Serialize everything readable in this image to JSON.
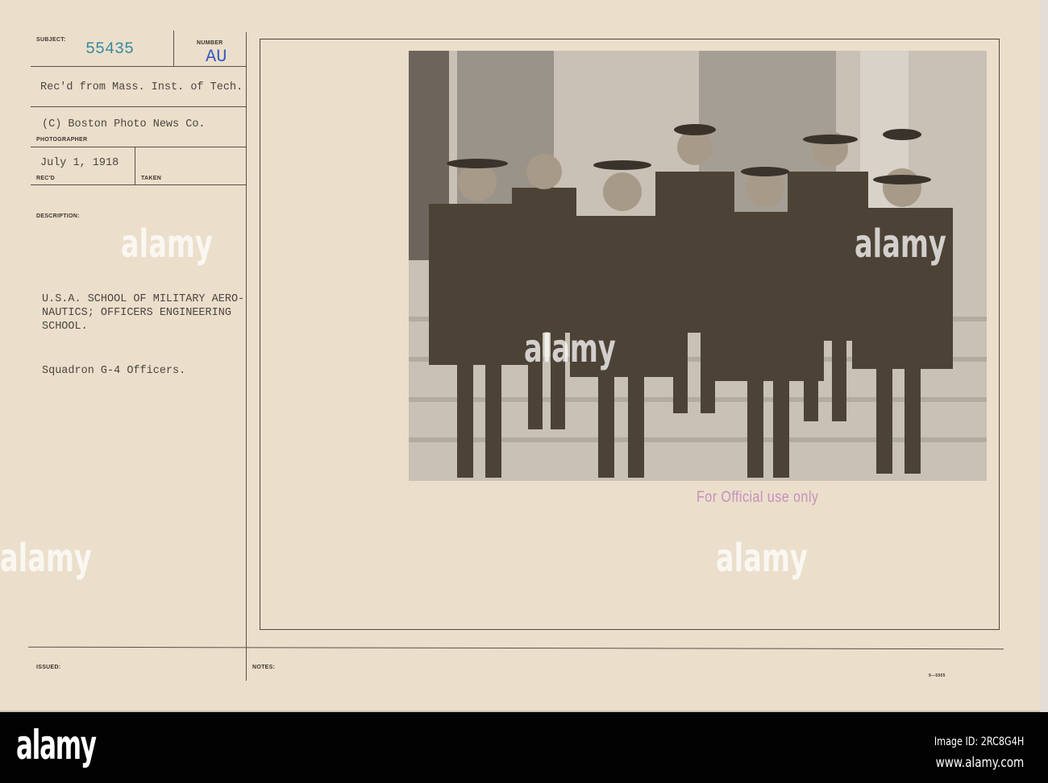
{
  "card": {
    "labels": {
      "subject": "SUBJECT:",
      "number": "NUMBER",
      "photographer": "PHOTOGRAPHER",
      "recd": "REC'D",
      "taken": "TAKEN",
      "description": "DESCRIPTION:",
      "issued": "ISSUED:",
      "notes": "NOTES:"
    },
    "subject_number": "55435",
    "number_code": "AU",
    "received_from": "Rec'd from Mass. Inst. of Tech.",
    "photographer": "(C) Boston Photo News Co.",
    "recd_date": "July 1, 1918",
    "description_lines": [
      "U.S.A. SCHOOL OF MILITARY AERO-",
      "NAUTICS; OFFICERS ENGINEERING",
      "SCHOOL."
    ],
    "caption": "Squadron G-4 Officers.",
    "stamp": "For Official use only",
    "form_code": "9—5005",
    "colors": {
      "subject_number": "#3a8aa0",
      "number_code": "#3d5cc0",
      "stamp": "#c58fbd"
    }
  },
  "watermark": "alamy",
  "footer": {
    "logo": "alamy",
    "image_id": "Image ID: 2RC8G4H",
    "website": "www.alamy.com"
  }
}
